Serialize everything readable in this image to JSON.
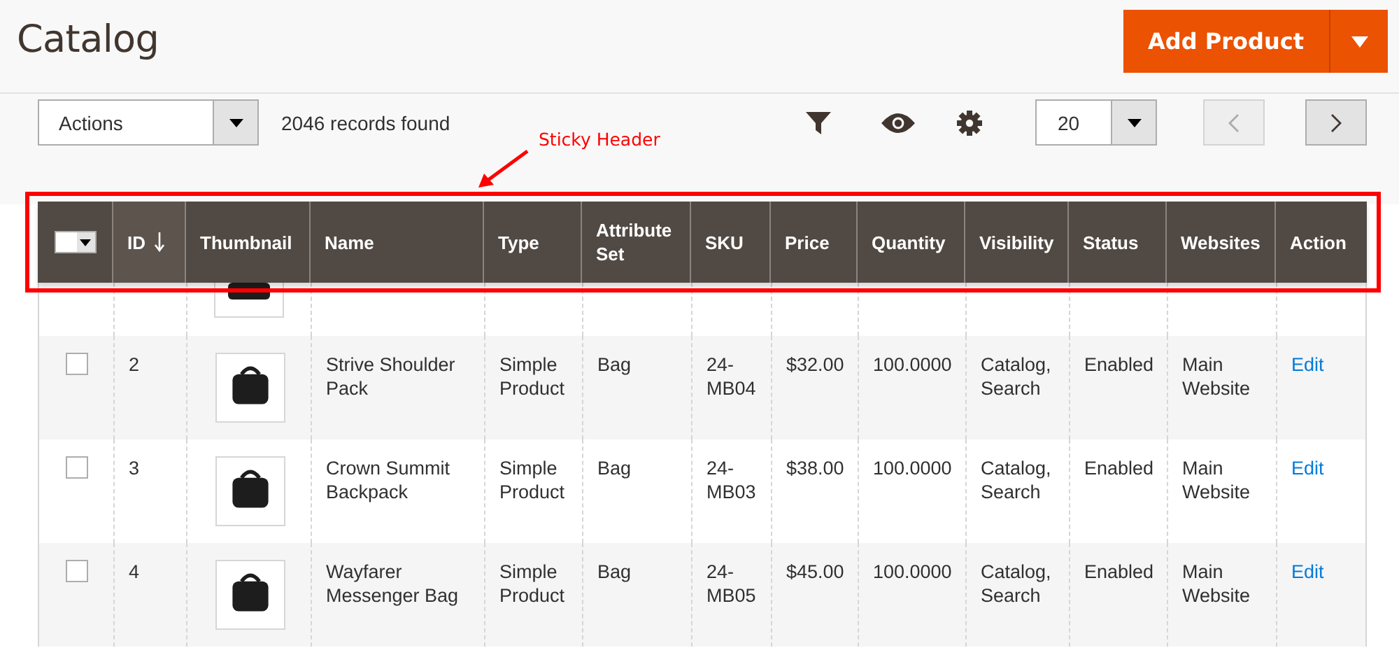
{
  "page_title": "Catalog",
  "add_button": {
    "label": "Add Product"
  },
  "toolbar": {
    "actions": "Actions",
    "records": "2046 records found",
    "per_page": "20",
    "prev_disabled": true,
    "next_disabled": false
  },
  "annotation": {
    "label": "Sticky Header"
  },
  "table": {
    "columns": [
      {
        "label": "ID",
        "sorted": true
      },
      {
        "label": "Thumbnail",
        "sorted": false
      },
      {
        "label": "Name",
        "sorted": false
      },
      {
        "label": "Type",
        "sorted": false
      },
      {
        "label": "Attribute Set",
        "sorted": false
      },
      {
        "label": "SKU",
        "sorted": false
      },
      {
        "label": "Price",
        "sorted": false
      },
      {
        "label": "Quantity",
        "sorted": false
      },
      {
        "label": "Visibility",
        "sorted": false
      },
      {
        "label": "Status",
        "sorted": false
      },
      {
        "label": "Websites",
        "sorted": false
      },
      {
        "label": "Action",
        "sorted": false
      }
    ],
    "rows": [
      {
        "checked": false,
        "id": "2",
        "name": "Strive Shoulder Pack",
        "type": "Simple Product",
        "attribute_set": "Bag",
        "sku": "24-MB04",
        "price": "$32.00",
        "quantity": "100.0000",
        "visibility": "Catalog, Search",
        "status": "Enabled",
        "websites": "Main Website",
        "action": "Edit"
      },
      {
        "checked": false,
        "id": "3",
        "name": "Crown Summit Backpack",
        "type": "Simple Product",
        "attribute_set": "Bag",
        "sku": "24-MB03",
        "price": "$38.00",
        "quantity": "100.0000",
        "visibility": "Catalog, Search",
        "status": "Enabled",
        "websites": "Main Website",
        "action": "Edit"
      },
      {
        "checked": false,
        "id": "4",
        "name": "Wayfarer Messenger Bag",
        "type": "Simple Product",
        "attribute_set": "Bag",
        "sku": "24-MB05",
        "price": "$45.00",
        "quantity": "100.0000",
        "visibility": "Catalog, Search",
        "status": "Enabled",
        "websites": "Main Website",
        "action": "Edit"
      }
    ]
  }
}
